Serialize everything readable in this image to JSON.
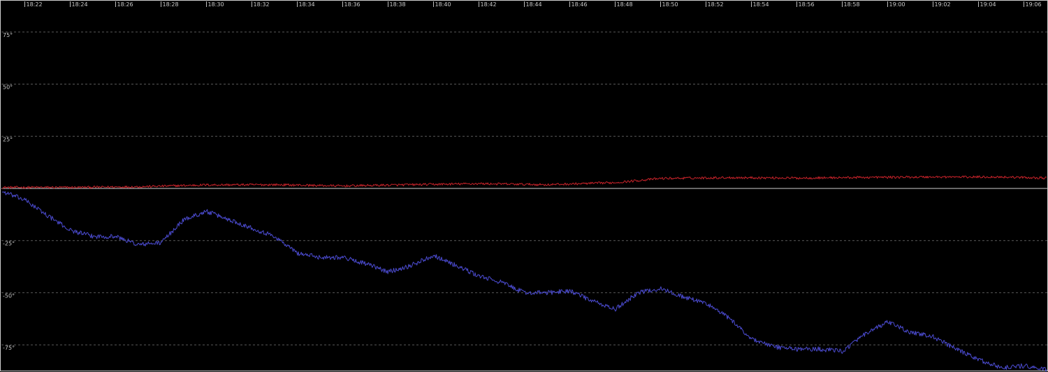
{
  "chart_data": {
    "type": "line",
    "x_ticks": [
      "18:22",
      "18:24",
      "18:26",
      "18:28",
      "18:30",
      "18:32",
      "18:34",
      "18:36",
      "18:38",
      "18:40",
      "18:42",
      "18:44",
      "18:46",
      "18:48",
      "18:50",
      "18:52",
      "18:54",
      "18:56",
      "18:58",
      "19:00",
      "19:02",
      "19:04",
      "19:06"
    ],
    "x_range": [
      "18:21",
      "19:07"
    ],
    "y_ticks": [
      "75°",
      "50°",
      "25°",
      "-25°",
      "-50°",
      "-75°"
    ],
    "y_tick_values": [
      75,
      50,
      25,
      -25,
      -50,
      -75
    ],
    "ylim": [
      -88,
      90
    ],
    "zero_line": true,
    "grid": "dashed horizontal",
    "series": [
      {
        "color": "#c8232a",
        "x": [
          "18:21",
          "18:24",
          "18:27",
          "18:30",
          "18:33",
          "18:36",
          "18:39",
          "18:42",
          "18:45",
          "18:48",
          "18:50",
          "18:53",
          "18:56",
          "18:59",
          "19:02",
          "19:05",
          "19:07"
        ],
        "values": [
          0.5,
          0.5,
          0.8,
          1.7,
          1.8,
          1.2,
          1.8,
          2.3,
          1.8,
          2.8,
          4.8,
          5.2,
          5.0,
          5.3,
          5.5,
          5.5,
          5.0
        ]
      },
      {
        "color": "#4b4bd0",
        "x": [
          "18:21",
          "18:22",
          "18:23",
          "18:24",
          "18:25",
          "18:26",
          "18:27",
          "18:28",
          "18:29",
          "18:30",
          "18:31",
          "18:32",
          "18:33",
          "18:34",
          "18:35",
          "18:36",
          "18:37",
          "18:38",
          "18:39",
          "18:40",
          "18:41",
          "18:42",
          "18:43",
          "18:44",
          "18:45",
          "18:46",
          "18:47",
          "18:48",
          "18:49",
          "18:50",
          "18:51",
          "18:52",
          "18:53",
          "18:54",
          "18:55",
          "18:56",
          "18:57",
          "18:58",
          "18:59",
          "19:00",
          "19:01",
          "19:02",
          "19:03",
          "19:04",
          "19:05",
          "19:06",
          "19:07"
        ],
        "values": [
          -1.5,
          -5.5,
          -13,
          -20,
          -23,
          -23,
          -27,
          -26,
          -15,
          -11,
          -15,
          -19,
          -23,
          -31,
          -33,
          -33,
          -36,
          -40,
          -37,
          -32,
          -37,
          -42,
          -45,
          -50,
          -50,
          -49,
          -54,
          -58,
          -50,
          -48,
          -52,
          -55,
          -62,
          -72,
          -76,
          -77,
          -77,
          -78,
          -70,
          -64,
          -69,
          -71,
          -77,
          -82,
          -86,
          -85,
          -87
        ]
      }
    ]
  }
}
